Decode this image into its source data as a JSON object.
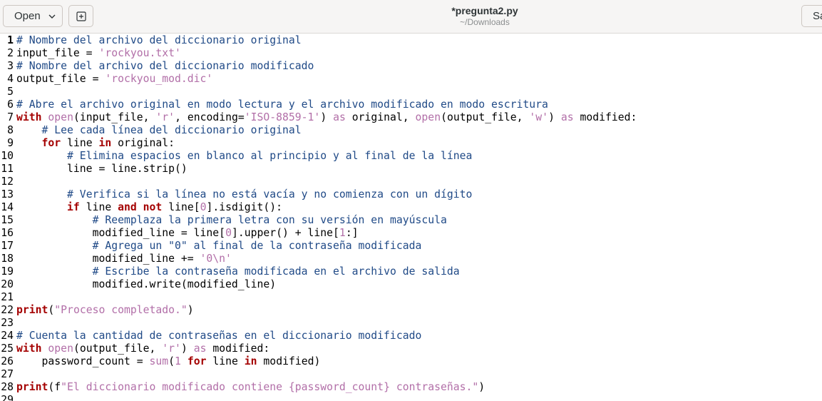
{
  "header": {
    "open_label": "Open",
    "title": "*pregunta2.py",
    "subtitle": "~/Downloads",
    "save_label": "Sa"
  },
  "icons": {
    "open_dropdown": "chevron-down-icon",
    "new_tab": "new-tab-icon"
  },
  "colors": {
    "comment": "#204a87",
    "string": "#b26fa8",
    "keyword": "#a40000",
    "header_bg": "#f6f5f4"
  },
  "editor": {
    "current_line": 1,
    "lines": [
      {
        "num": "1",
        "tokens": [
          {
            "t": "cm",
            "v": "# Nombre del archivo del diccionario original"
          }
        ]
      },
      {
        "num": "2",
        "tokens": [
          {
            "t": "tx",
            "v": "input_file = "
          },
          {
            "t": "st",
            "v": "'rockyou.txt'"
          }
        ]
      },
      {
        "num": "3",
        "tokens": [
          {
            "t": "cm",
            "v": "# Nombre del archivo del diccionario modificado"
          }
        ]
      },
      {
        "num": "4",
        "tokens": [
          {
            "t": "tx",
            "v": "output_file = "
          },
          {
            "t": "st",
            "v": "'rockyou_mod.dic'"
          }
        ]
      },
      {
        "num": "5",
        "tokens": []
      },
      {
        "num": "6",
        "tokens": [
          {
            "t": "cm",
            "v": "# Abre el archivo original en modo lectura y el archivo modificado en modo escritura"
          }
        ]
      },
      {
        "num": "7",
        "tokens": [
          {
            "t": "kw",
            "v": "with"
          },
          {
            "t": "tx",
            "v": " "
          },
          {
            "t": "bi",
            "v": "open"
          },
          {
            "t": "tx",
            "v": "(input_file, "
          },
          {
            "t": "st",
            "v": "'r'"
          },
          {
            "t": "tx",
            "v": ", encoding="
          },
          {
            "t": "st",
            "v": "'ISO-8859-1'"
          },
          {
            "t": "tx",
            "v": ") "
          },
          {
            "t": "bi",
            "v": "as"
          },
          {
            "t": "tx",
            "v": " original, "
          },
          {
            "t": "bi",
            "v": "open"
          },
          {
            "t": "tx",
            "v": "(output_file, "
          },
          {
            "t": "st",
            "v": "'w'"
          },
          {
            "t": "tx",
            "v": ") "
          },
          {
            "t": "bi",
            "v": "as"
          },
          {
            "t": "tx",
            "v": " modified:"
          }
        ]
      },
      {
        "num": "8",
        "tokens": [
          {
            "t": "tx",
            "v": "    "
          },
          {
            "t": "cm",
            "v": "# Lee cada línea del diccionario original"
          }
        ]
      },
      {
        "num": "9",
        "tokens": [
          {
            "t": "tx",
            "v": "    "
          },
          {
            "t": "kw",
            "v": "for"
          },
          {
            "t": "tx",
            "v": " line "
          },
          {
            "t": "kw",
            "v": "in"
          },
          {
            "t": "tx",
            "v": " original:"
          }
        ]
      },
      {
        "num": "10",
        "tokens": [
          {
            "t": "tx",
            "v": "        "
          },
          {
            "t": "cm",
            "v": "# Elimina espacios en blanco al principio y al final de la línea"
          }
        ]
      },
      {
        "num": "11",
        "tokens": [
          {
            "t": "tx",
            "v": "        line = line.strip()"
          }
        ]
      },
      {
        "num": "12",
        "tokens": []
      },
      {
        "num": "13",
        "tokens": [
          {
            "t": "tx",
            "v": "        "
          },
          {
            "t": "cm",
            "v": "# Verifica si la línea no está vacía y no comienza con un dígito"
          }
        ]
      },
      {
        "num": "14",
        "tokens": [
          {
            "t": "tx",
            "v": "        "
          },
          {
            "t": "kw",
            "v": "if"
          },
          {
            "t": "tx",
            "v": " line "
          },
          {
            "t": "kw",
            "v": "and"
          },
          {
            "t": "tx",
            "v": " "
          },
          {
            "t": "kw",
            "v": "not"
          },
          {
            "t": "tx",
            "v": " line["
          },
          {
            "t": "st",
            "v": "0"
          },
          {
            "t": "tx",
            "v": "].isdigit():"
          }
        ]
      },
      {
        "num": "15",
        "tokens": [
          {
            "t": "tx",
            "v": "            "
          },
          {
            "t": "cm",
            "v": "# Reemplaza la primera letra con su versión en mayúscula"
          }
        ]
      },
      {
        "num": "16",
        "tokens": [
          {
            "t": "tx",
            "v": "            modified_line = line["
          },
          {
            "t": "st",
            "v": "0"
          },
          {
            "t": "tx",
            "v": "].upper() + line["
          },
          {
            "t": "st",
            "v": "1"
          },
          {
            "t": "tx",
            "v": ":]"
          }
        ]
      },
      {
        "num": "17",
        "tokens": [
          {
            "t": "tx",
            "v": "            "
          },
          {
            "t": "cm",
            "v": "# Agrega un \"0\" al final de la contraseña modificada"
          }
        ]
      },
      {
        "num": "18",
        "tokens": [
          {
            "t": "tx",
            "v": "            modified_line += "
          },
          {
            "t": "st",
            "v": "'0\\n'"
          }
        ]
      },
      {
        "num": "19",
        "tokens": [
          {
            "t": "tx",
            "v": "            "
          },
          {
            "t": "cm",
            "v": "# Escribe la contraseña modificada en el archivo de salida"
          }
        ]
      },
      {
        "num": "20",
        "tokens": [
          {
            "t": "tx",
            "v": "            modified.write(modified_line)"
          }
        ]
      },
      {
        "num": "21",
        "tokens": []
      },
      {
        "num": "22",
        "tokens": [
          {
            "t": "kw",
            "v": "print"
          },
          {
            "t": "tx",
            "v": "("
          },
          {
            "t": "st",
            "v": "\"Proceso completado.\""
          },
          {
            "t": "tx",
            "v": ")"
          }
        ]
      },
      {
        "num": "23",
        "tokens": []
      },
      {
        "num": "24",
        "tokens": [
          {
            "t": "cm",
            "v": "# Cuenta la cantidad de contraseñas en el diccionario modificado"
          }
        ]
      },
      {
        "num": "25",
        "tokens": [
          {
            "t": "kw",
            "v": "with"
          },
          {
            "t": "tx",
            "v": " "
          },
          {
            "t": "bi",
            "v": "open"
          },
          {
            "t": "tx",
            "v": "(output_file, "
          },
          {
            "t": "st",
            "v": "'r'"
          },
          {
            "t": "tx",
            "v": ") "
          },
          {
            "t": "bi",
            "v": "as"
          },
          {
            "t": "tx",
            "v": " modified:"
          }
        ]
      },
      {
        "num": "26",
        "tokens": [
          {
            "t": "tx",
            "v": "    password_count = "
          },
          {
            "t": "bi",
            "v": "sum"
          },
          {
            "t": "tx",
            "v": "("
          },
          {
            "t": "st",
            "v": "1"
          },
          {
            "t": "tx",
            "v": " "
          },
          {
            "t": "kw",
            "v": "for"
          },
          {
            "t": "tx",
            "v": " line "
          },
          {
            "t": "kw",
            "v": "in"
          },
          {
            "t": "tx",
            "v": " modified)"
          }
        ]
      },
      {
        "num": "27",
        "tokens": []
      },
      {
        "num": "28",
        "tokens": [
          {
            "t": "kw",
            "v": "print"
          },
          {
            "t": "tx",
            "v": "(f"
          },
          {
            "t": "st",
            "v": "\"El diccionario modificado contiene {password_count} contraseñas.\""
          },
          {
            "t": "tx",
            "v": ")"
          }
        ]
      },
      {
        "num": "29",
        "tokens": []
      }
    ]
  }
}
